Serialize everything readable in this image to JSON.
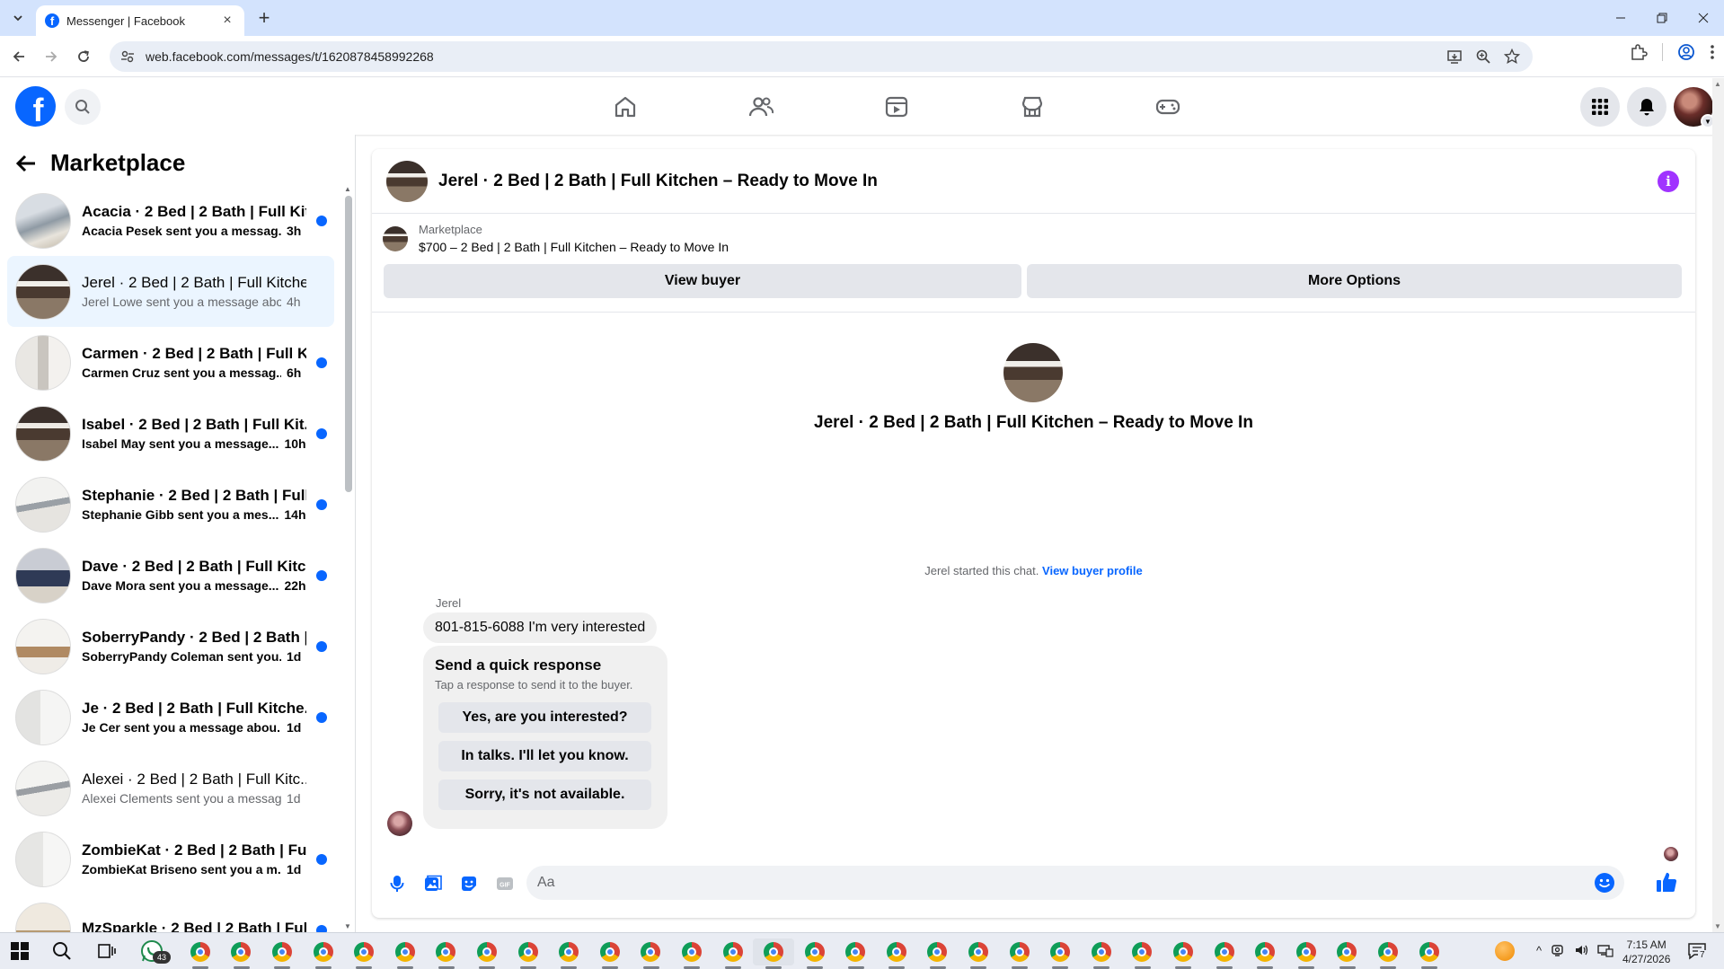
{
  "browser": {
    "tab_title": "Messenger | Facebook",
    "url": "web.facebook.com/messages/t/1620878458992268"
  },
  "fb": {
    "logo_letter": "f"
  },
  "sidebar": {
    "title": "Marketplace",
    "conversations": [
      {
        "title": "Acacia · 2 Bed | 2 Bath | Full Kit...",
        "snippet": "Acacia Pesek sent you a messag...",
        "time": "3h",
        "unread": true
      },
      {
        "title": "Jerel · 2 Bed | 2 Bath | Full Kitche...",
        "snippet": "Jerel Lowe sent you a message abo...",
        "time": "4h",
        "unread": false
      },
      {
        "title": "Carmen · 2 Bed | 2 Bath | Full K...",
        "snippet": "Carmen Cruz sent you a messag...",
        "time": "6h",
        "unread": true
      },
      {
        "title": "Isabel · 2 Bed | 2 Bath | Full Kit...",
        "snippet": "Isabel May sent you a message...",
        "time": "10h",
        "unread": true
      },
      {
        "title": "Stephanie · 2 Bed | 2 Bath | Full...",
        "snippet": "Stephanie Gibb sent you a mes...",
        "time": "14h",
        "unread": true
      },
      {
        "title": "Dave · 2 Bed | 2 Bath | Full Kitc...",
        "snippet": "Dave Mora sent you a message...",
        "time": "22h",
        "unread": true
      },
      {
        "title": "SoberryPandy · 2 Bed | 2 Bath |...",
        "snippet": "SoberryPandy Coleman sent you...",
        "time": "1d",
        "unread": true
      },
      {
        "title": "Je · 2 Bed | 2 Bath | Full Kitche...",
        "snippet": "Je Cer sent you a message abou...",
        "time": "1d",
        "unread": true
      },
      {
        "title": "Alexei · 2 Bed | 2 Bath | Full Kitc...",
        "snippet": "Alexei Clements sent you a messag...",
        "time": "1d",
        "unread": false
      },
      {
        "title": "ZombieKat · 2 Bed | 2 Bath | Fu...",
        "snippet": "ZombieKat Briseno sent you a m...",
        "time": "1d",
        "unread": true
      },
      {
        "title": "MzSparkle · 2 Bed | 2 Bath | Ful...",
        "snippet": "",
        "time": "",
        "unread": true
      }
    ]
  },
  "chat": {
    "header_title": "Jerel · 2 Bed | 2 Bath | Full Kitchen – Ready to Move In",
    "listing_label": "Marketplace",
    "listing_price": "$700 – 2 Bed | 2 Bath | Full Kitchen – Ready to Move In",
    "view_buyer_label": "View buyer",
    "more_options_label": "More Options",
    "intro_title": "Jerel · 2 Bed | 2 Bath | Full Kitchen – Ready to Move In",
    "started_text": "Jerel started this chat.",
    "view_profile_link": "View buyer profile",
    "sender_name": "Jerel",
    "message": "801-815-6088 I'm very interested",
    "quick_title": "Send a quick response",
    "quick_sub": "Tap a response to send it to the buyer.",
    "quick_responses": [
      "Yes, are you interested?",
      "In talks. I'll let you know.",
      "Sorry, it's not available."
    ],
    "composer_placeholder": "Aa"
  },
  "taskbar": {
    "whatsapp_badge": "43",
    "time": "7:15 AM",
    "date": "4/27/2026",
    "notif_count": "7"
  },
  "colors": {
    "fb_blue": "#0866ff",
    "active_row": "#ebf5ff",
    "info_purple": "#a033ff"
  }
}
